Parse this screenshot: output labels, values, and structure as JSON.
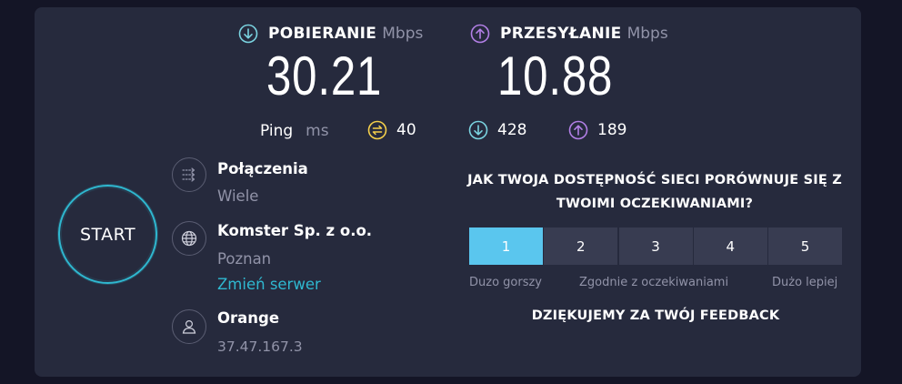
{
  "download": {
    "label": "POBIERANIE",
    "unit": "Mbps",
    "value": "30.21",
    "icon": "download-arrow-icon",
    "color": "#7ad3e0"
  },
  "upload": {
    "label": "PRZESYŁANIE",
    "unit": "Mbps",
    "value": "10.88",
    "icon": "upload-arrow-icon",
    "color": "#b27fe6"
  },
  "ping": {
    "label": "Ping",
    "unit": "ms",
    "idle": {
      "value": "40",
      "icon": "ping-idle-icon",
      "color": "#f5d04b"
    },
    "download": {
      "value": "428",
      "icon": "ping-download-icon",
      "color": "#7ad3e0"
    },
    "upload": {
      "value": "189",
      "icon": "ping-upload-icon",
      "color": "#b27fe6"
    }
  },
  "start_label": "START",
  "connections": {
    "title": "Połączenia",
    "value": "Wiele",
    "icon": "connections-icon"
  },
  "server": {
    "title": "Komster Sp. z o.o.",
    "location": "Poznan",
    "change_label": "Zmień serwer",
    "icon": "globe-icon"
  },
  "provider": {
    "title": "Orange",
    "ip": "37.47.167.3",
    "icon": "user-icon"
  },
  "feedback": {
    "question": "JAK TWOJA DOSTĘPNOŚĆ SIECI PORÓWNUJE SIĘ Z TWOIMI OCZEKIWANIAMI?",
    "options": [
      "1",
      "2",
      "3",
      "4",
      "5"
    ],
    "selected": "1",
    "left_label": "Duzo gorszy",
    "middle_label": "Zgodnie z oczekiwaniami",
    "right_label": "Dużo lepiej",
    "thanks": "DZIĘKUJEMY ZA TWÓJ FEEDBACK"
  },
  "colors": {
    "background": "#141526",
    "card": "#262a3d",
    "accent": "#2fb8d0",
    "selected": "#5ac6ee",
    "muted": "#9193a8"
  }
}
